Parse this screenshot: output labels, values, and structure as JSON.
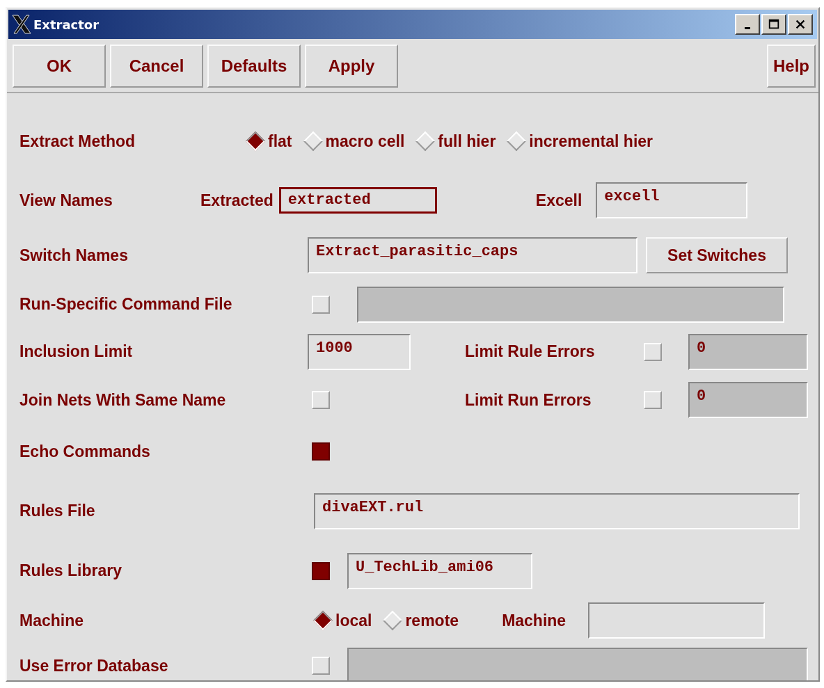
{
  "window": {
    "title": "Extractor"
  },
  "buttons": [
    {
      "label": "OK"
    },
    {
      "label": "Cancel"
    },
    {
      "label": "Defaults"
    },
    {
      "label": "Apply"
    }
  ],
  "help_button": {
    "label": "Help"
  },
  "extract_method": {
    "label": "Extract Method",
    "options": [
      {
        "label": "flat",
        "selected": true
      },
      {
        "label": "macro cell",
        "selected": false
      },
      {
        "label": "full hier",
        "selected": false
      },
      {
        "label": "incremental hier",
        "selected": false
      }
    ]
  },
  "view_names": {
    "label": "View Names",
    "extracted_label": "Extracted",
    "extracted_value": "extracted",
    "extracted_focused": true,
    "excell_label": "Excell",
    "excell_value": "excell"
  },
  "switch_names": {
    "label": "Switch Names",
    "value": "Extract_parasitic_caps",
    "button": "Set Switches"
  },
  "run_specific_command_file": {
    "label": "Run-Specific Command File",
    "checked": false
  },
  "inclusion_limit": {
    "label": "Inclusion Limit",
    "value": "1000"
  },
  "limit_rule_errors": {
    "label": "Limit Rule Errors",
    "checked": false,
    "value": "0"
  },
  "join_nets": {
    "label": "Join Nets With Same Name",
    "checked": false
  },
  "limit_run_errors": {
    "label": "Limit Run Errors",
    "checked": false,
    "value": "0"
  },
  "echo_commands": {
    "label": "Echo Commands",
    "checked": true
  },
  "rules_file": {
    "label": "Rules File",
    "value": "divaEXT.rul"
  },
  "rules_library": {
    "label": "Rules Library",
    "checked": true,
    "value": "U_TechLib_ami06"
  },
  "machine": {
    "label": "Machine",
    "options": [
      {
        "label": "local",
        "selected": true
      },
      {
        "label": "remote",
        "selected": false
      }
    ],
    "machine_label": "Machine"
  },
  "use_error_database": {
    "label": "Use Error Database",
    "checked": false
  }
}
